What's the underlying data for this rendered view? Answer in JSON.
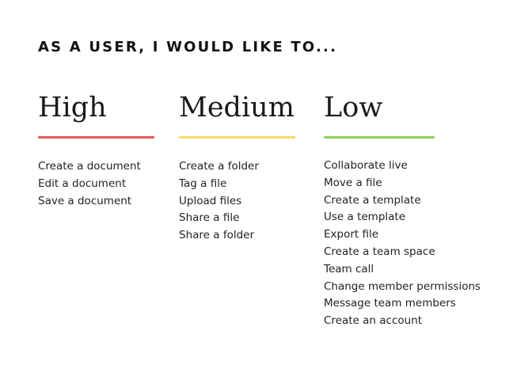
{
  "heading": "AS A USER, I WOULD LIKE TO...",
  "columns": [
    {
      "key": "high",
      "title": "High",
      "rule_color": "#e8585a",
      "items": [
        "Create a document",
        "Edit a document",
        "Save a document"
      ]
    },
    {
      "key": "medium",
      "title": "Medium",
      "rule_color": "#fcd96a",
      "items": [
        "Create a folder",
        "Tag a file",
        "Upload files",
        "Share a file",
        "Share a folder"
      ]
    },
    {
      "key": "low",
      "title": "Low",
      "rule_color": "#88d35b",
      "items": [
        "Collaborate live",
        "Move a file",
        "Create a template",
        "Use a template",
        "Export file",
        "Create a team space",
        "Team call",
        "Change member permissions",
        "Message team members",
        "Create an account"
      ]
    }
  ]
}
